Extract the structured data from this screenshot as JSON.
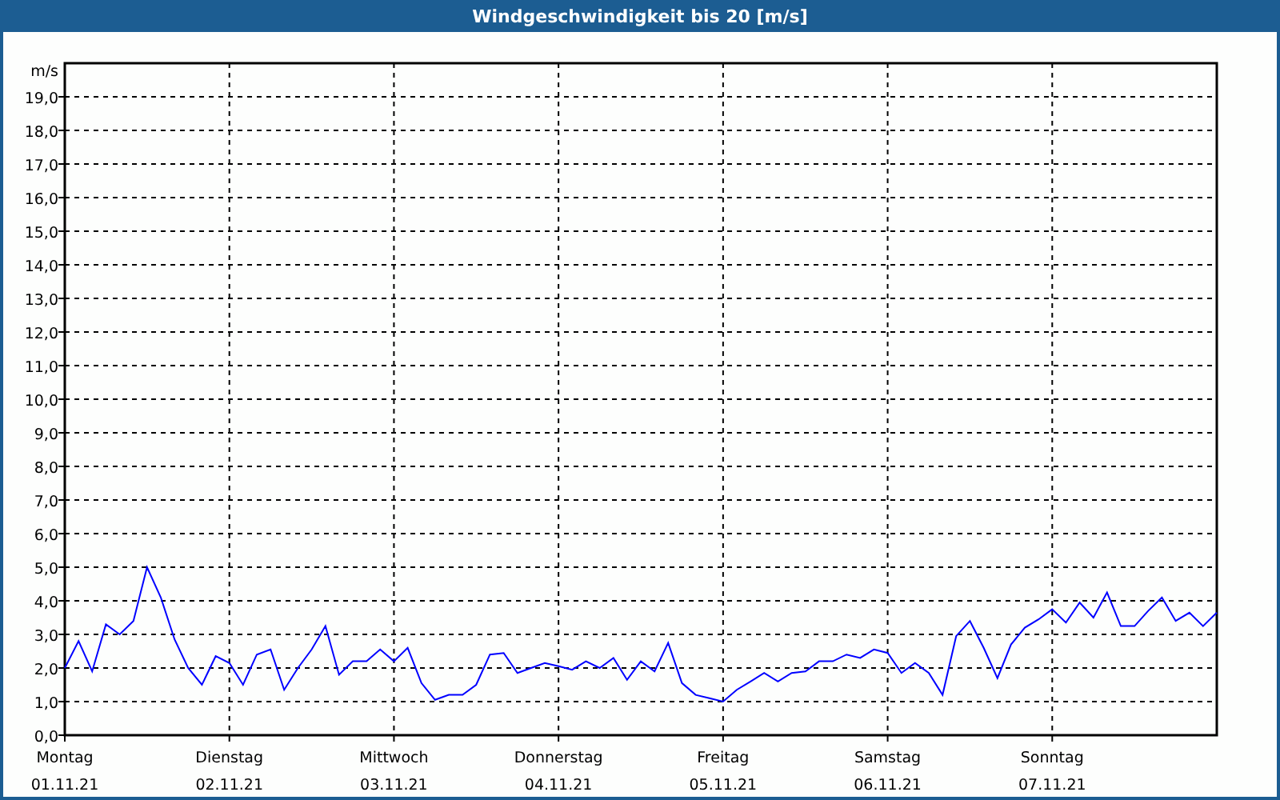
{
  "window": {
    "title": "Windgeschwindigkeit bis 20 [m/s]"
  },
  "chart": {
    "chart_data": {
      "type": "line",
      "ylabel": "m/s",
      "categories": [
        "Montag 01.11.21",
        null,
        null,
        null,
        null,
        null,
        null,
        null,
        null,
        null,
        null,
        null,
        "Dienstag 02.11.21",
        null,
        null,
        null,
        null,
        null,
        null,
        null,
        null,
        null,
        null,
        null,
        "Mittwoch 03.11.21",
        null,
        null,
        null,
        null,
        null,
        null,
        null,
        null,
        null,
        null,
        null,
        "Donnerstag 04.11.21",
        null,
        null,
        null,
        null,
        null,
        null,
        null,
        null,
        null,
        null,
        null,
        "Freitag 05.11.21",
        null,
        null,
        null,
        null,
        null,
        null,
        null,
        null,
        null,
        null,
        null,
        "Samstag 06.11.21",
        null,
        null,
        null,
        null,
        null,
        null,
        null,
        null,
        null,
        null,
        null,
        "Sonntag 07.11.21",
        null,
        null,
        null,
        null,
        null,
        null,
        null,
        null,
        null,
        null,
        null,
        null
      ],
      "series": [
        {
          "color": "#0000ff",
          "values": [
            2.0,
            2.8,
            1.9,
            3.3,
            3.0,
            3.4,
            5.0,
            4.1,
            2.85,
            2.0,
            1.5,
            2.35,
            2.15,
            1.5,
            2.4,
            2.55,
            1.35,
            2.0,
            2.55,
            3.25,
            1.8,
            2.2,
            2.2,
            2.55,
            2.2,
            2.6,
            1.55,
            1.05,
            1.2,
            1.2,
            1.5,
            2.4,
            2.45,
            1.85,
            2.0,
            2.15,
            2.05,
            1.95,
            2.2,
            2.0,
            2.3,
            1.65,
            2.2,
            1.9,
            2.75,
            1.55,
            1.2,
            1.1,
            1.0,
            1.35,
            1.6,
            1.85,
            1.6,
            1.85,
            1.9,
            2.2,
            2.2,
            2.4,
            2.3,
            2.55,
            2.45,
            1.85,
            2.15,
            1.85,
            1.2,
            2.95,
            3.4,
            2.6,
            1.7,
            2.7,
            3.2,
            3.45,
            3.75,
            3.35,
            3.95,
            3.5,
            4.25,
            3.25,
            3.25,
            3.7,
            4.1,
            3.4,
            3.65,
            3.25,
            3.65
          ]
        }
      ],
      "ylim": [
        0,
        20
      ],
      "grid": true,
      "yticks": [
        {
          "value": 0,
          "label": "0,0"
        },
        {
          "value": 1,
          "label": "1,0"
        },
        {
          "value": 2,
          "label": "2,0"
        },
        {
          "value": 3,
          "label": "3,0"
        },
        {
          "value": 4,
          "label": "4,0"
        },
        {
          "value": 5,
          "label": "5,0"
        },
        {
          "value": 6,
          "label": "6,0"
        },
        {
          "value": 7,
          "label": "7,0"
        },
        {
          "value": 8,
          "label": "8,0"
        },
        {
          "value": 9,
          "label": "9,0"
        },
        {
          "value": 10,
          "label": "10,0"
        },
        {
          "value": 11,
          "label": "11,0"
        },
        {
          "value": 12,
          "label": "12,0"
        },
        {
          "value": 13,
          "label": "13,0"
        },
        {
          "value": 14,
          "label": "14,0"
        },
        {
          "value": 15,
          "label": "15,0"
        },
        {
          "value": 16,
          "label": "16,0"
        },
        {
          "value": 17,
          "label": "17,0"
        },
        {
          "value": 18,
          "label": "18,0"
        },
        {
          "value": 19,
          "label": "19,0"
        }
      ]
    }
  }
}
